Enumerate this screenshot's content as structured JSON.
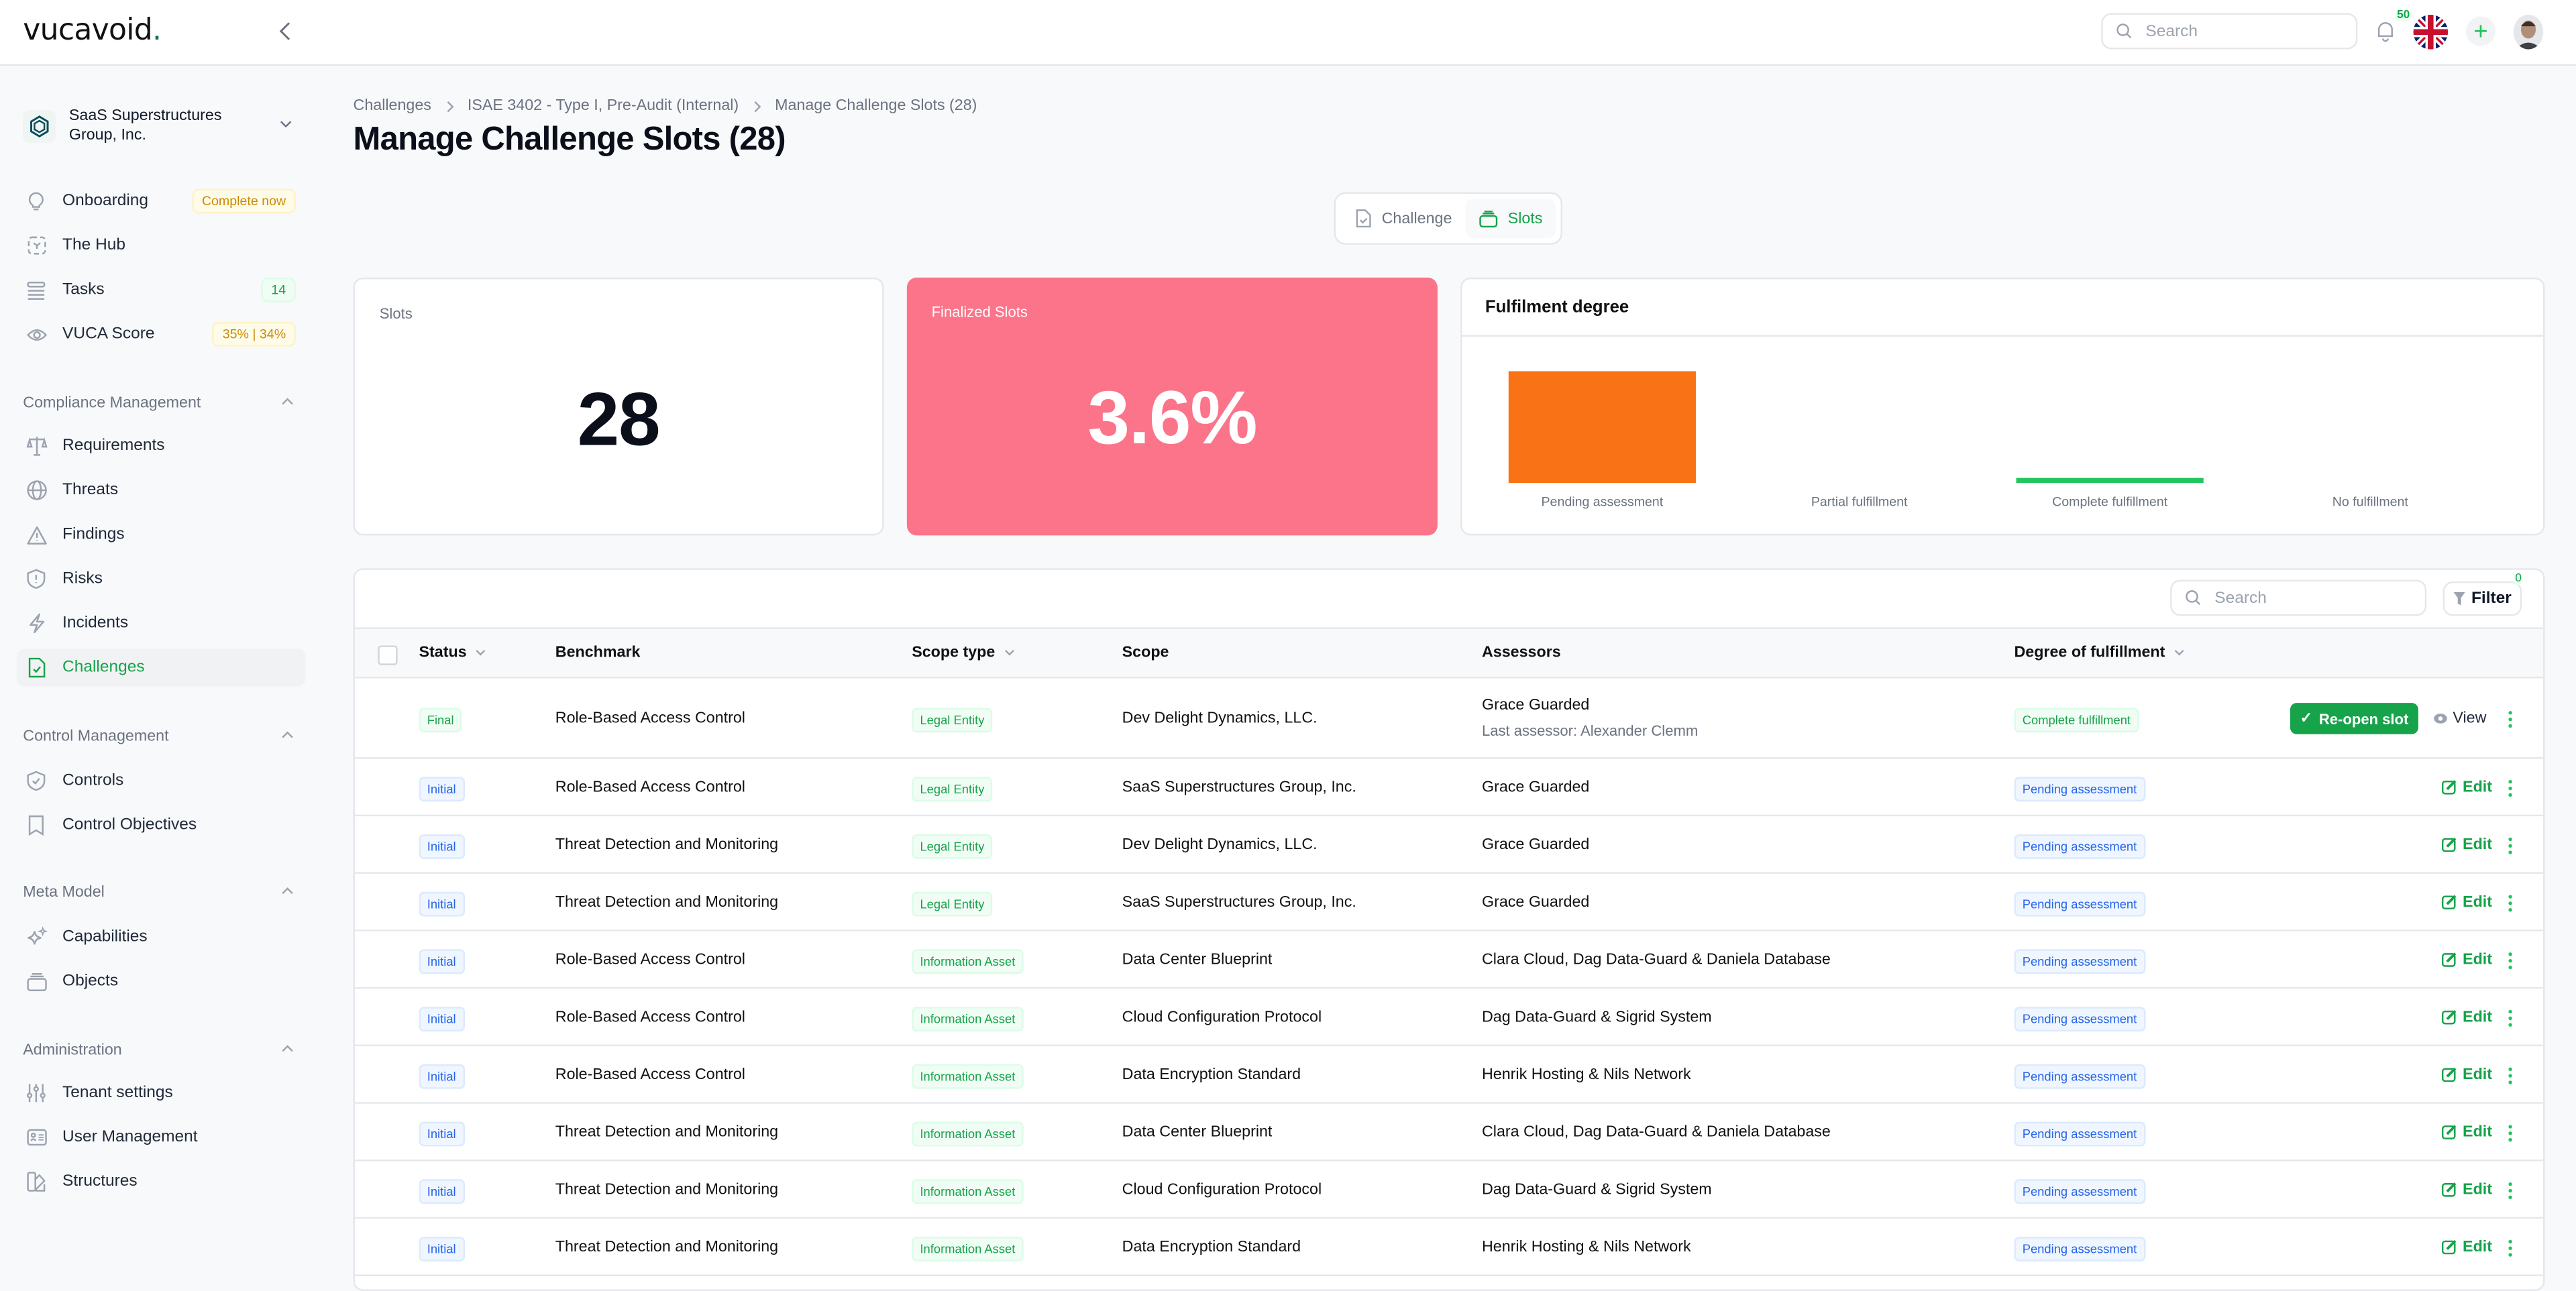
{
  "app": {
    "logo_text": "vucavoid",
    "logo_dot": "."
  },
  "topbar": {
    "search_placeholder": "Search",
    "notification_count": "50",
    "language": "English (UK)",
    "add_icon": "plus-icon"
  },
  "sidebar": {
    "org_name": "SaaS Superstructures Group, Inc.",
    "items": [
      {
        "label": "Onboarding",
        "icon": "lightbulb-icon",
        "badge": "Complete now"
      },
      {
        "label": "The Hub",
        "icon": "hub-icon"
      },
      {
        "label": "Tasks",
        "icon": "list-icon",
        "badge": "14"
      },
      {
        "label": "VUCA Score",
        "icon": "eye-icon",
        "badge": "35% | 34%"
      }
    ],
    "sections": [
      {
        "title": "Compliance Management",
        "items": [
          {
            "label": "Requirements",
            "icon": "scale-icon"
          },
          {
            "label": "Threats",
            "icon": "globe-icon"
          },
          {
            "label": "Findings",
            "icon": "warning-icon"
          },
          {
            "label": "Risks",
            "icon": "shield-alert-icon"
          },
          {
            "label": "Incidents",
            "icon": "bolt-icon"
          },
          {
            "label": "Challenges",
            "icon": "file-check-icon",
            "active": true
          }
        ]
      },
      {
        "title": "Control Management",
        "items": [
          {
            "label": "Controls",
            "icon": "shield-check-icon"
          },
          {
            "label": "Control Objectives",
            "icon": "bookmark-icon"
          }
        ]
      },
      {
        "title": "Meta Model",
        "items": [
          {
            "label": "Capabilities",
            "icon": "sparkles-icon"
          },
          {
            "label": "Objects",
            "icon": "stack-icon"
          }
        ]
      },
      {
        "title": "Administration",
        "items": [
          {
            "label": "Tenant settings",
            "icon": "sliders-icon"
          },
          {
            "label": "User Management",
            "icon": "id-card-icon"
          },
          {
            "label": "Structures",
            "icon": "swatch-icon"
          }
        ]
      }
    ]
  },
  "breadcrumb": [
    "Challenges",
    "ISAE 3402 - Type I, Pre-Audit (Internal)",
    "Manage Challenge Slots (28)"
  ],
  "page_title": "Manage Challenge Slots (28)",
  "view_toggle": {
    "challenge": "Challenge",
    "slots": "Slots",
    "active": "Slots"
  },
  "stats": {
    "slots_label": "Slots",
    "slots_value": "28",
    "finalized_label": "Finalized Slots",
    "finalized_value": "3.6%"
  },
  "chart_data": {
    "type": "bar",
    "title": "Fulfilment degree",
    "categories": [
      "Pending assessment",
      "Partial fulfillment",
      "Complete fulfillment",
      "No fulfillment"
    ],
    "values": [
      27,
      0,
      1,
      0
    ],
    "colors": [
      "#f97316",
      "#eab308",
      "#22c55e",
      "#ef4444"
    ],
    "xlabel": "",
    "ylabel": "",
    "ylim": [
      0,
      27
    ],
    "grid": false
  },
  "table": {
    "search_placeholder": "Search",
    "filter_label": "Filter",
    "filter_count": "0",
    "columns": {
      "status": "Status",
      "benchmark": "Benchmark",
      "scope_type": "Scope type",
      "scope": "Scope",
      "assessors": "Assessors",
      "degree": "Degree of fulfillment"
    },
    "rows": [
      {
        "status": "Final",
        "benchmark": "Role-Based Access Control",
        "scope_type": "Legal Entity",
        "scope": "Dev Delight Dynamics, LLC.",
        "assessors": "Grace Guarded",
        "last_assessor": "Last assessor: Alexander Clemm",
        "degree": "Complete fulfillment",
        "actions": [
          "Re-open slot",
          "View"
        ]
      },
      {
        "status": "Initial",
        "benchmark": "Role-Based Access Control",
        "scope_type": "Legal Entity",
        "scope": "SaaS Superstructures Group, Inc.",
        "assessors": "Grace Guarded",
        "degree": "Pending assessment",
        "actions": [
          "Edit"
        ]
      },
      {
        "status": "Initial",
        "benchmark": "Threat Detection and Monitoring",
        "scope_type": "Legal Entity",
        "scope": "Dev Delight Dynamics, LLC.",
        "assessors": "Grace Guarded",
        "degree": "Pending assessment",
        "actions": [
          "Edit"
        ]
      },
      {
        "status": "Initial",
        "benchmark": "Threat Detection and Monitoring",
        "scope_type": "Legal Entity",
        "scope": "SaaS Superstructures Group, Inc.",
        "assessors": "Grace Guarded",
        "degree": "Pending assessment",
        "actions": [
          "Edit"
        ]
      },
      {
        "status": "Initial",
        "benchmark": "Role-Based Access Control",
        "scope_type": "Information Asset",
        "scope": "Data Center Blueprint",
        "assessors": "Clara Cloud, Dag Data-Guard & Daniela Database",
        "degree": "Pending assessment",
        "actions": [
          "Edit"
        ]
      },
      {
        "status": "Initial",
        "benchmark": "Role-Based Access Control",
        "scope_type": "Information Asset",
        "scope": "Cloud Configuration Protocol",
        "assessors": "Dag Data-Guard & Sigrid System",
        "degree": "Pending assessment",
        "actions": [
          "Edit"
        ]
      },
      {
        "status": "Initial",
        "benchmark": "Role-Based Access Control",
        "scope_type": "Information Asset",
        "scope": "Data Encryption Standard",
        "assessors": "Henrik Hosting & Nils Network",
        "degree": "Pending assessment",
        "actions": [
          "Edit"
        ]
      },
      {
        "status": "Initial",
        "benchmark": "Threat Detection and Monitoring",
        "scope_type": "Information Asset",
        "scope": "Data Center Blueprint",
        "assessors": "Clara Cloud, Dag Data-Guard & Daniela Database",
        "degree": "Pending assessment",
        "actions": [
          "Edit"
        ]
      },
      {
        "status": "Initial",
        "benchmark": "Threat Detection and Monitoring",
        "scope_type": "Information Asset",
        "scope": "Cloud Configuration Protocol",
        "assessors": "Dag Data-Guard & Sigrid System",
        "degree": "Pending assessment",
        "actions": [
          "Edit"
        ]
      },
      {
        "status": "Initial",
        "benchmark": "Threat Detection and Monitoring",
        "scope_type": "Information Asset",
        "scope": "Data Encryption Standard",
        "assessors": "Henrik Hosting & Nils Network",
        "degree": "Pending assessment",
        "actions": [
          "Edit"
        ]
      }
    ]
  }
}
